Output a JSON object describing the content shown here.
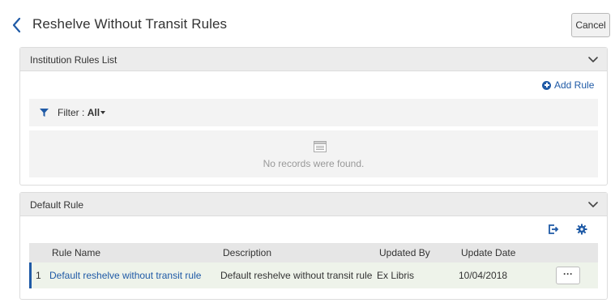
{
  "header": {
    "title": "Reshelve Without Transit Rules",
    "cancel_label": "Cancel"
  },
  "institution_panel": {
    "title": "Institution Rules List",
    "add_rule_label": "Add Rule",
    "filter_label": "Filter :",
    "filter_value": "All",
    "empty_message": "No records were found."
  },
  "default_panel": {
    "title": "Default Rule",
    "columns": [
      "Rule Name",
      "Description",
      "Updated By",
      "Update Date"
    ],
    "rows": [
      {
        "index": "1",
        "rule_name": "Default reshelve without transit rule",
        "description": "Default reshelve without transit rule",
        "updated_by": "Ex Libris",
        "update_date": "10/04/2018",
        "actions_label": "···"
      }
    ]
  },
  "icons": {
    "back": "chevron-left-icon",
    "collapse": "chevron-down-icon",
    "add": "plus-circle-icon",
    "filter": "filter-icon",
    "empty": "list-icon",
    "export": "export-icon",
    "settings": "gear-icon"
  },
  "colors": {
    "link": "#1f5aa6",
    "panel_header": "#ececec",
    "row_highlight": "#eef3ea"
  }
}
